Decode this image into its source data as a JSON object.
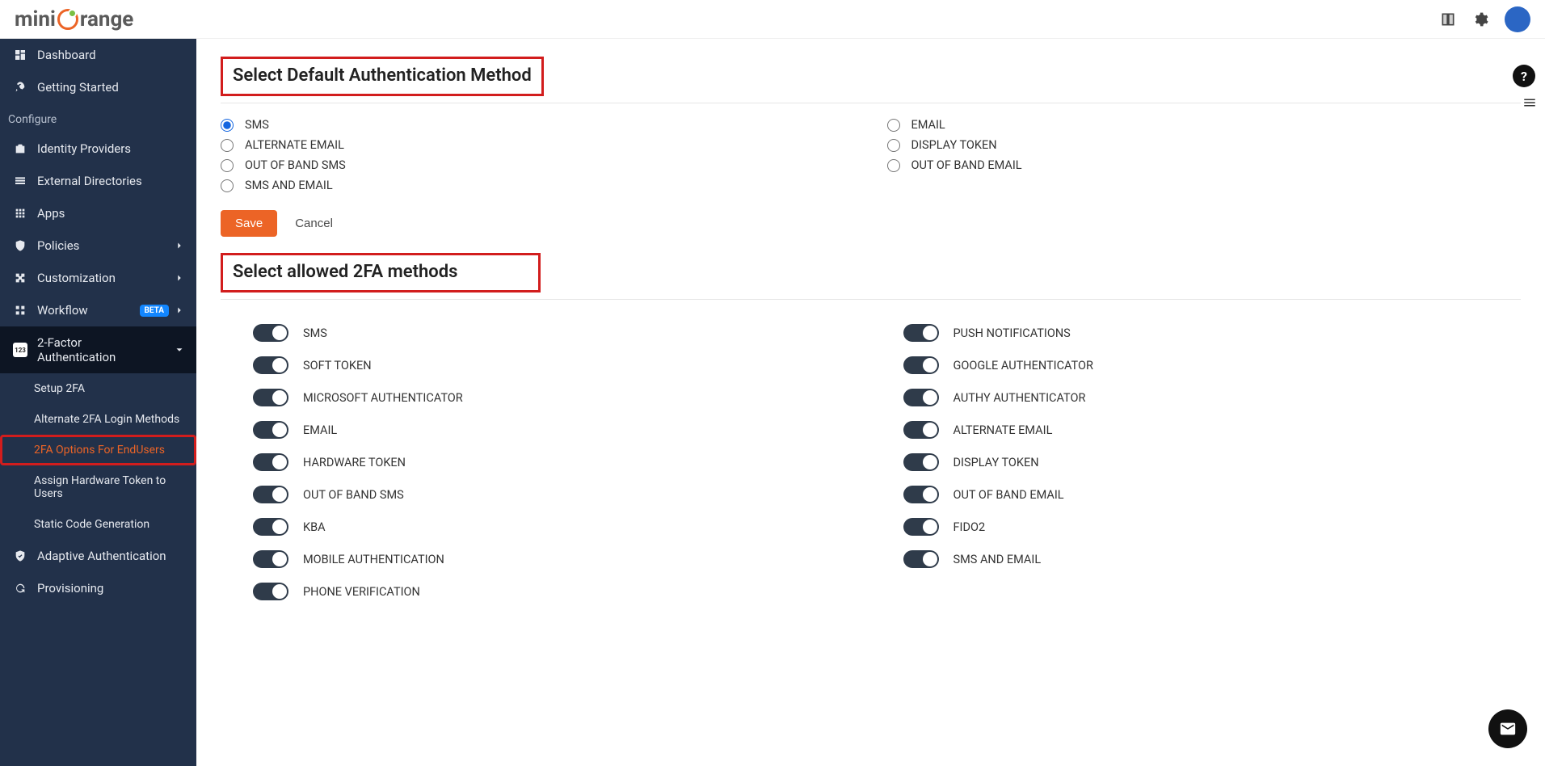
{
  "header": {
    "logo_prefix": "mini",
    "logo_suffix": "range"
  },
  "sidebar": {
    "dashboard": "Dashboard",
    "getting_started": "Getting Started",
    "configure_heading": "Configure",
    "identity_providers": "Identity Providers",
    "external_directories": "External Directories",
    "apps": "Apps",
    "policies": "Policies",
    "customization": "Customization",
    "workflow": "Workflow",
    "workflow_badge": "BETA",
    "two_factor": "2-Factor Authentication",
    "sub_setup": "Setup 2FA",
    "sub_alternate": "Alternate 2FA Login Methods",
    "sub_options": "2FA Options For EndUsers",
    "sub_assign": "Assign Hardware Token to Users",
    "sub_static": "Static Code Generation",
    "adaptive": "Adaptive Authentication",
    "provisioning": "Provisioning"
  },
  "main": {
    "heading1": "Select Default Authentication Method",
    "radios_left": {
      "0": "SMS",
      "1": "ALTERNATE EMAIL",
      "2": "OUT OF BAND SMS",
      "3": "SMS AND EMAIL"
    },
    "radios_right": {
      "0": "EMAIL",
      "1": "DISPLAY TOKEN",
      "2": "OUT OF BAND EMAIL"
    },
    "save": "Save",
    "cancel": "Cancel",
    "heading2": "Select allowed 2FA methods",
    "toggles_left": {
      "0": "SMS",
      "1": "SOFT TOKEN",
      "2": "MICROSOFT AUTHENTICATOR",
      "3": "EMAIL",
      "4": "HARDWARE TOKEN",
      "5": "OUT OF BAND SMS",
      "6": "KBA",
      "7": "MOBILE AUTHENTICATION",
      "8": "PHONE VERIFICATION"
    },
    "toggles_right": {
      "0": "PUSH NOTIFICATIONS",
      "1": "GOOGLE AUTHENTICATOR",
      "2": "AUTHY AUTHENTICATOR",
      "3": "ALTERNATE EMAIL",
      "4": "DISPLAY TOKEN",
      "5": "OUT OF BAND EMAIL",
      "6": "FIDO2",
      "7": "SMS AND EMAIL"
    }
  },
  "help": "?"
}
